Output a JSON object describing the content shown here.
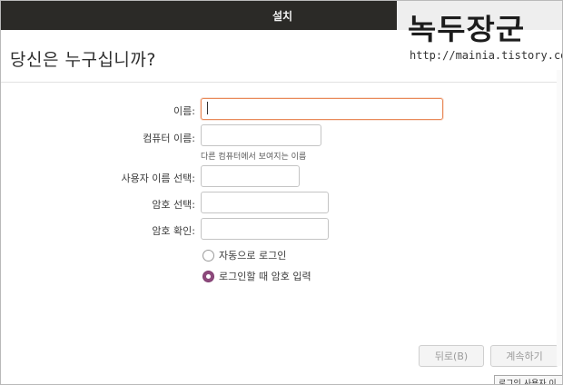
{
  "window": {
    "title": "설치"
  },
  "page": {
    "title": "당신은 누구십니까?"
  },
  "watermark": {
    "title": "녹두장군",
    "url": "http://mainia.tistory.com"
  },
  "form": {
    "name": {
      "label": "이름:",
      "value": ""
    },
    "computer_name": {
      "label": "컴퓨터 이름:",
      "value": "",
      "hint": "다른 컴퓨터에서 보여지는 이름"
    },
    "username": {
      "label": "사용자 이름 선택:",
      "value": ""
    },
    "password": {
      "label": "암호 선택:",
      "value": ""
    },
    "password_confirm": {
      "label": "암호 확인:",
      "value": ""
    }
  },
  "login_options": [
    {
      "label": "자동으로 로그인",
      "selected": false
    },
    {
      "label": "로그인할 때 암호 입력",
      "selected": true
    }
  ],
  "buttons": {
    "back": "뒤로(B)",
    "continue": "계속하기"
  },
  "tooltip": {
    "text": "로그인 사용자 이"
  },
  "colors": {
    "titlebar": "#2b2a27",
    "focus_border": "#e98a5a",
    "radio_selected": "#8e4b7d"
  }
}
